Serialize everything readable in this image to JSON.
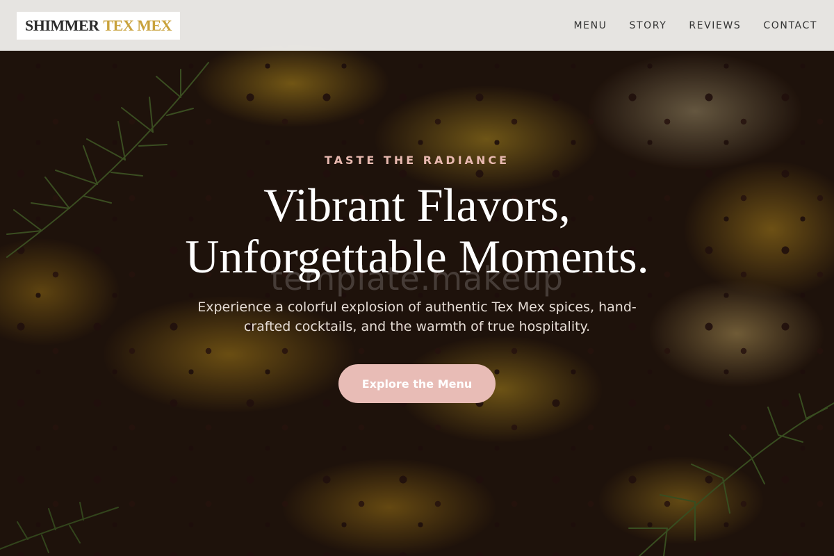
{
  "brand": {
    "name_main": "SHIMMER",
    "name_accent": "TEX MEX",
    "accent_color": "#c9a23c"
  },
  "nav": {
    "items": [
      {
        "label": "MENU"
      },
      {
        "label": "STORY"
      },
      {
        "label": "REVIEWS"
      },
      {
        "label": "CONTACT"
      }
    ]
  },
  "hero": {
    "eyebrow": "TASTE THE RADIANCE",
    "headline_line1": "Vibrant Flavors,",
    "headline_line2": "Unforgettable Moments.",
    "watermark": "template.makeup",
    "subtext": "Experience a colorful explosion of authentic Tex Mex spices, hand-crafted cocktails, and the warmth of true hospitality.",
    "cta_label": "Explore the Menu",
    "cta_color": "#e8bcb6",
    "eyebrow_color": "#e8b9b0"
  }
}
